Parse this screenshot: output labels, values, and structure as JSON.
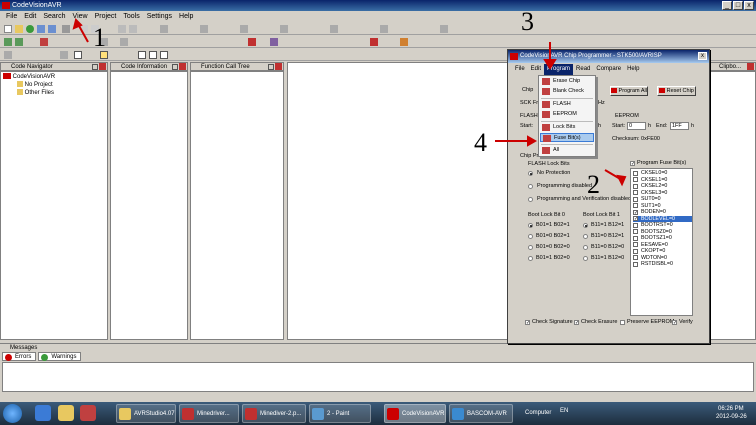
{
  "app": {
    "title": "CodeVisionAVR"
  },
  "menu": [
    "File",
    "Edit",
    "Search",
    "View",
    "Project",
    "Tools",
    "Settings",
    "Help"
  ],
  "panels": {
    "navigator": {
      "title": "Code Navigator",
      "root": "CodeVisionAVR",
      "items": [
        "No Project",
        "Other Files"
      ]
    },
    "info": {
      "title": "Code Information"
    },
    "calltree": {
      "title": "Function Call Tree"
    },
    "clipboard": {
      "title": "Clipbo..."
    }
  },
  "messages": {
    "title": "Messages",
    "tabs": [
      "Errors",
      "Warnings"
    ]
  },
  "dialog": {
    "title": "CodeVisionAVR Chip Programmer - STK500/AVRISP",
    "menu": [
      "File",
      "Edit",
      "Program",
      "Read",
      "Compare",
      "Help"
    ],
    "selected_menu": "Program",
    "chip_label": "Chip",
    "sck_label": "SCK Fre",
    "hz": "Hz",
    "flash_label": "FLASH",
    "eeprom_label": "EEPROM",
    "start_label": "Start:",
    "h": "h",
    "eeprom_start": "0",
    "end_label": "End:",
    "eeprom_end": "1FF",
    "checksum": "Checksum: 0xFE00",
    "chip_prog_label": "Chip Pro",
    "program_all": "Program All",
    "reset_chip": "Reset Chip",
    "flash_lock_label": "FLASH Lock Bits",
    "lock_options": [
      "No Protection",
      "Programming disabled",
      "Programming and Verification disabled"
    ],
    "boot0_label": "Boot Lock Bit 0",
    "boot1_label": "Boot Lock Bit 1",
    "boot0_options": [
      "B01=1 B02=1",
      "B01=0 B02=1",
      "B01=0 B02=0",
      "B01=1 B02=0"
    ],
    "boot1_options": [
      "B11=1 B12=1",
      "B11=0 B12=1",
      "B11=0 B12=0",
      "B11=1 B12=0"
    ],
    "program_fuse": "Program Fuse Bit(s)",
    "fuses": [
      {
        "name": "CKSEL0=0",
        "checked": false
      },
      {
        "name": "CKSEL1=0",
        "checked": false
      },
      {
        "name": "CKSEL2=0",
        "checked": false
      },
      {
        "name": "CKSEL3=0",
        "checked": false
      },
      {
        "name": "SUT0=0",
        "checked": false
      },
      {
        "name": "SUT1=0",
        "checked": false
      },
      {
        "name": "BODEN=0",
        "checked": true
      },
      {
        "name": "BODLEVEL=0",
        "checked": true
      },
      {
        "name": "BOOTRST=0",
        "checked": false
      },
      {
        "name": "BOOTSZ0=0",
        "checked": false
      },
      {
        "name": "BOOTSZ1=0",
        "checked": false
      },
      {
        "name": "EESAVE=0",
        "checked": false
      },
      {
        "name": "CKOPT=0",
        "checked": false
      },
      {
        "name": "WDTON=0",
        "checked": false
      },
      {
        "name": "RSTDISBL=0",
        "checked": false
      }
    ],
    "bottom_checks": [
      {
        "label": "Check Signature",
        "checked": true
      },
      {
        "label": "Check Erasure",
        "checked": true
      },
      {
        "label": "Preserve EEPROM",
        "checked": false
      },
      {
        "label": "Verify",
        "checked": true
      }
    ]
  },
  "program_menu": [
    "Erase Chip",
    "Blank Check",
    "FLASH",
    "EEPROM",
    "Lock Bits",
    "Fuse Bit(s)",
    "All"
  ],
  "annotations": [
    "1",
    "2",
    "3",
    "4"
  ],
  "taskbar": {
    "tasks": [
      "AVRStudio4.07",
      "Minedriver...",
      "Minediver-2.p...",
      "2 - Paint",
      "CodeVisionAVR",
      "BASCOM-AVR"
    ],
    "computer": "Computer",
    "lang": "EN",
    "time": "06:26 PM",
    "date": "2012-09-26"
  },
  "colors": {
    "accent": "#0a246a",
    "highlight": "#316ac5",
    "annotation_arrow": "#cc0000"
  }
}
